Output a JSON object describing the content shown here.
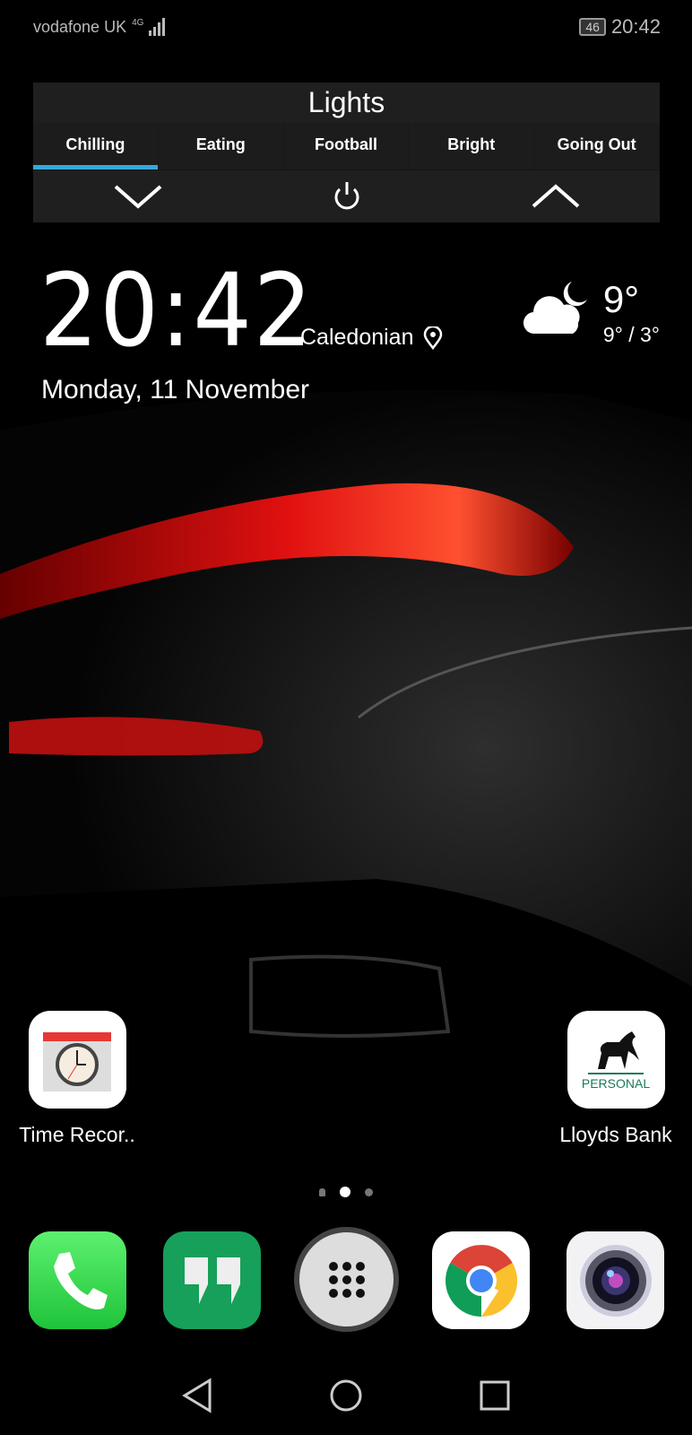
{
  "status_bar": {
    "carrier": "vodafone UK",
    "network": "4G",
    "battery": "46",
    "time": "20:42"
  },
  "lights_widget": {
    "title": "Lights",
    "tabs": [
      {
        "label": "Chilling",
        "active": true
      },
      {
        "label": "Eating"
      },
      {
        "label": "Football"
      },
      {
        "label": "Bright"
      },
      {
        "label": "Going Out"
      }
    ],
    "accent": "#33a9dc",
    "controls": [
      "chevron-down-icon",
      "power-icon",
      "chevron-up-icon"
    ]
  },
  "clock": {
    "time": "20:42",
    "location": "Caledonian",
    "date": "Monday, 11 November"
  },
  "weather": {
    "temp": "9°",
    "range": "9° / 3°",
    "icon": "cloudy-night-icon"
  },
  "apps": [
    {
      "label": "Time Recor.."
    },
    {
      "label": "Lloyds Bank",
      "badge": "PERSONAL"
    }
  ],
  "page_indicator": {
    "pages": 3,
    "current": 2
  },
  "dock": [
    "phone",
    "hangouts",
    "app-drawer",
    "chrome",
    "camera"
  ]
}
